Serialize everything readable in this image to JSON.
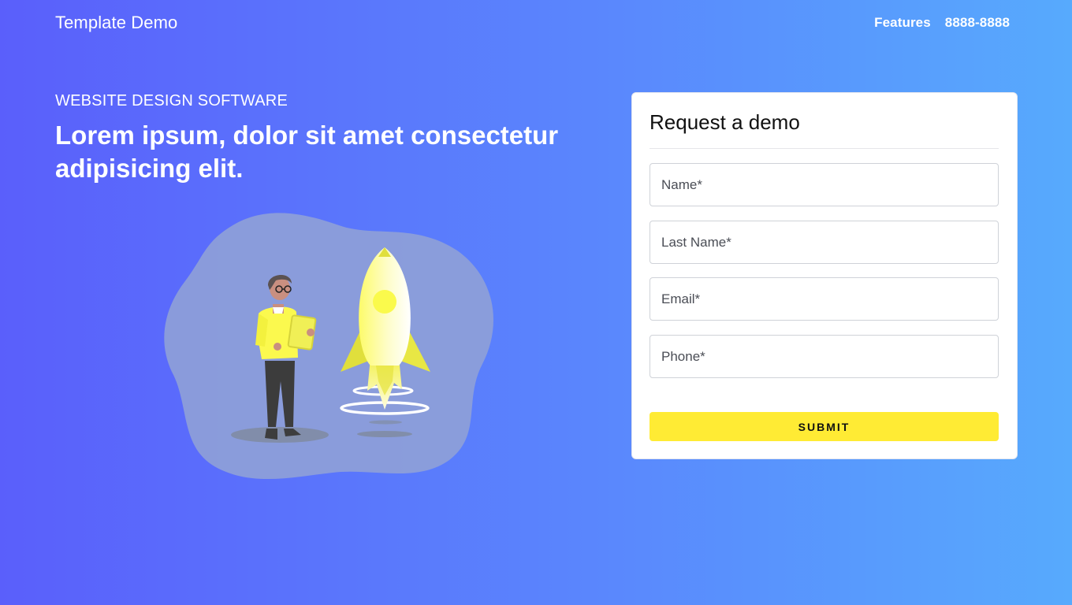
{
  "navbar": {
    "brand": "Template Demo",
    "links": [
      "Features",
      "8888-8888"
    ]
  },
  "hero": {
    "eyebrow": "WEBSITE DESIGN SOFTWARE",
    "headline": "Lorem ipsum, dolor sit amet consectetur adipisicing elit."
  },
  "form": {
    "title": "Request a demo",
    "fields": {
      "name_placeholder": "Name*",
      "last_name_placeholder": "Last Name*",
      "email_placeholder": "Email*",
      "phone_placeholder": "Phone*"
    },
    "submit_label": "SUBMIT"
  },
  "colors": {
    "gradient_start": "#5a5ffb",
    "gradient_end": "#57aafd",
    "accent_yellow": "#ffeb34",
    "card_background": "#ffffff"
  },
  "illustration": {
    "icon": "rocket-launch-illustration",
    "elements": [
      "person-with-tablet",
      "rocket",
      "launch-rings",
      "blob-background"
    ]
  }
}
